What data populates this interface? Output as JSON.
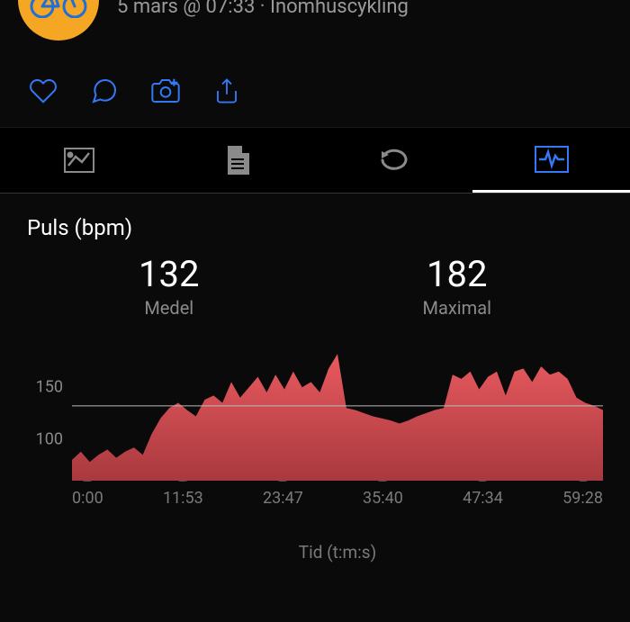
{
  "header": {
    "meta": "5 mars @ 07:33 · Inomhuscykling"
  },
  "chart": {
    "title": "Puls (bpm)",
    "stats": {
      "avg": {
        "value": "132",
        "label": "Medel"
      },
      "max": {
        "value": "182",
        "label": "Maximal"
      }
    },
    "xlabel": "Tid (t:m:s)"
  },
  "chart_data": {
    "type": "area",
    "title": "Puls (bpm)",
    "xlabel": "Tid (t:m:s)",
    "ylabel": "",
    "ylim": [
      60,
      190
    ],
    "yticks": [
      100,
      150
    ],
    "xticks": [
      "0:00",
      "11:53",
      "23:47",
      "35:40",
      "47:34",
      "59:28"
    ],
    "reference_line": 132,
    "series": [
      {
        "name": "Puls",
        "color": "#d64a4f",
        "x": [
          0,
          1,
          2,
          3,
          4,
          5,
          6,
          7,
          8,
          9,
          10,
          11,
          12,
          13,
          14,
          15,
          16,
          17,
          18,
          19,
          20,
          21,
          22,
          23,
          24,
          25,
          26,
          27,
          28,
          29,
          30,
          31,
          32,
          33,
          34,
          35,
          36,
          37,
          38,
          39,
          40,
          41,
          42,
          43,
          44,
          45,
          46,
          47,
          48,
          49,
          50,
          51,
          52,
          53,
          54,
          55,
          56,
          57,
          58,
          59,
          60
        ],
        "values": [
          80,
          88,
          78,
          85,
          90,
          82,
          88,
          92,
          85,
          105,
          120,
          130,
          135,
          128,
          122,
          138,
          142,
          135,
          155,
          140,
          150,
          160,
          145,
          162,
          148,
          165,
          150,
          155,
          145,
          168,
          182,
          130,
          128,
          125,
          122,
          120,
          118,
          115,
          118,
          122,
          125,
          128,
          130,
          162,
          158,
          165,
          148,
          160,
          165,
          142,
          165,
          168,
          155,
          170,
          162,
          165,
          158,
          140,
          135,
          132,
          128
        ]
      }
    ]
  }
}
